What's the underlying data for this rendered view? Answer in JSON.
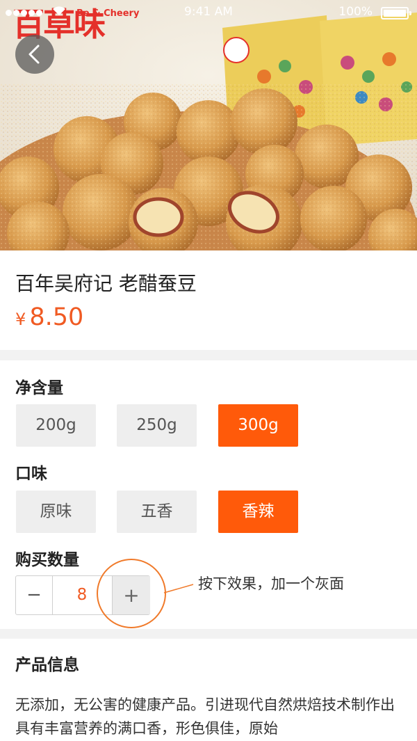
{
  "status_bar": {
    "carrier": "",
    "time": "9:41 AM",
    "battery": "100%"
  },
  "brand": {
    "logo_text": "百草味",
    "tagline": "Be & Cheery"
  },
  "product": {
    "title": "百年吴府记 老醋蚕豆",
    "currency": "¥",
    "price": "8.50"
  },
  "weight": {
    "label": "净含量",
    "options": [
      "200g",
      "250g",
      "300g"
    ],
    "selected": "300g"
  },
  "flavor": {
    "label": "口味",
    "options": [
      "原味",
      "五香",
      "香辣"
    ],
    "selected": "香辣"
  },
  "quantity": {
    "label": "购买数量",
    "minus": "−",
    "value": "8",
    "plus": "+"
  },
  "annotation": "按下效果，加一个灰面",
  "info": {
    "title": "产品信息",
    "body": "无添加，无公害的健康产品。引进现代自然烘焙技术制作出具有丰富营养的满口香，形色俱佳，原始"
  },
  "colors": {
    "accent": "#ff5a0a",
    "price": "#f05a22",
    "brand_red": "#e4302a"
  }
}
